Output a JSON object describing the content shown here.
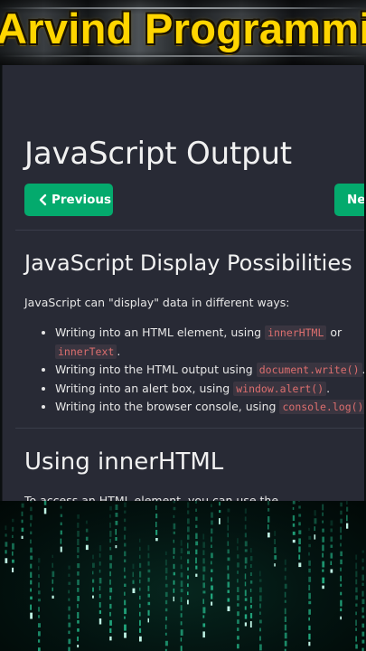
{
  "banner": {
    "title": "Arvind Programming"
  },
  "page": {
    "title": "JavaScript Output",
    "nav": {
      "prev_label": "Previous",
      "next_label": "Nex"
    },
    "section1": {
      "heading": "JavaScript Display Possibilities",
      "intro": "JavaScript can \"display\" data in different ways:",
      "items": [
        {
          "text": "Writing into an HTML element, using ",
          "code1": "innerHTML",
          "mid": " or",
          "code2": "innerText",
          "end": "."
        },
        {
          "text": "Writing into the HTML output using ",
          "code": "document.write()",
          "end": "."
        },
        {
          "text": "Writing into an alert box, using ",
          "code": "window.alert()",
          "end": "."
        },
        {
          "text": "Writing into the browser console, using ",
          "code": "console.log()",
          "end": "."
        }
      ]
    },
    "section2": {
      "heading": "Using innerHTML",
      "partial_text": "To access an HTML element, you can use the"
    }
  },
  "colors": {
    "panel_bg": "#282a35",
    "button_green": "#04aa6d",
    "code_text": "#dc6e6e",
    "banner_text": "#ffd500",
    "matrix_green": "#2bd6a0"
  },
  "icons": {
    "prev": "chevron-left-icon"
  }
}
